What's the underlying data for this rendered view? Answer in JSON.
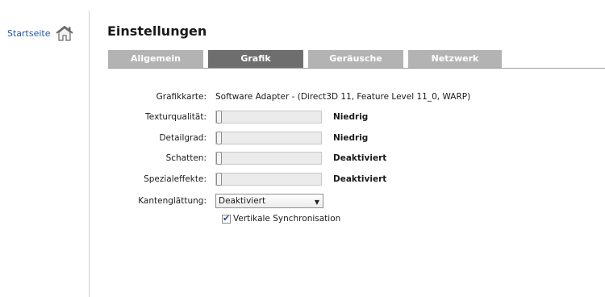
{
  "sidebar": {
    "home_label": "Startseite",
    "home_icon": "home-icon"
  },
  "header": {
    "title": "Einstellungen"
  },
  "tabs": [
    {
      "label": "Allgemein",
      "active": false
    },
    {
      "label": "Grafik",
      "active": true
    },
    {
      "label": "Geräusche",
      "active": false
    },
    {
      "label": "Netzwerk",
      "active": false
    }
  ],
  "settings": {
    "graphics_card": {
      "label": "Grafikkarte:",
      "value": "Software Adapter - (Direct3D 11, Feature Level 11_0, WARP)"
    },
    "texture_quality": {
      "label": "Texturqualität:",
      "status": "Niedrig",
      "level": 0
    },
    "detail_level": {
      "label": "Detailgrad:",
      "status": "Niedrig",
      "level": 0
    },
    "shadows": {
      "label": "Schatten:",
      "status": "Deaktiviert",
      "level": 0
    },
    "special_effects": {
      "label": "Spezialeffekte:",
      "status": "Deaktiviert",
      "level": 0
    },
    "antialiasing": {
      "label": "Kantenglättung:",
      "selected": "Deaktiviert"
    },
    "vsync": {
      "label": "Vertikale Synchronisation",
      "checked": true
    }
  }
}
